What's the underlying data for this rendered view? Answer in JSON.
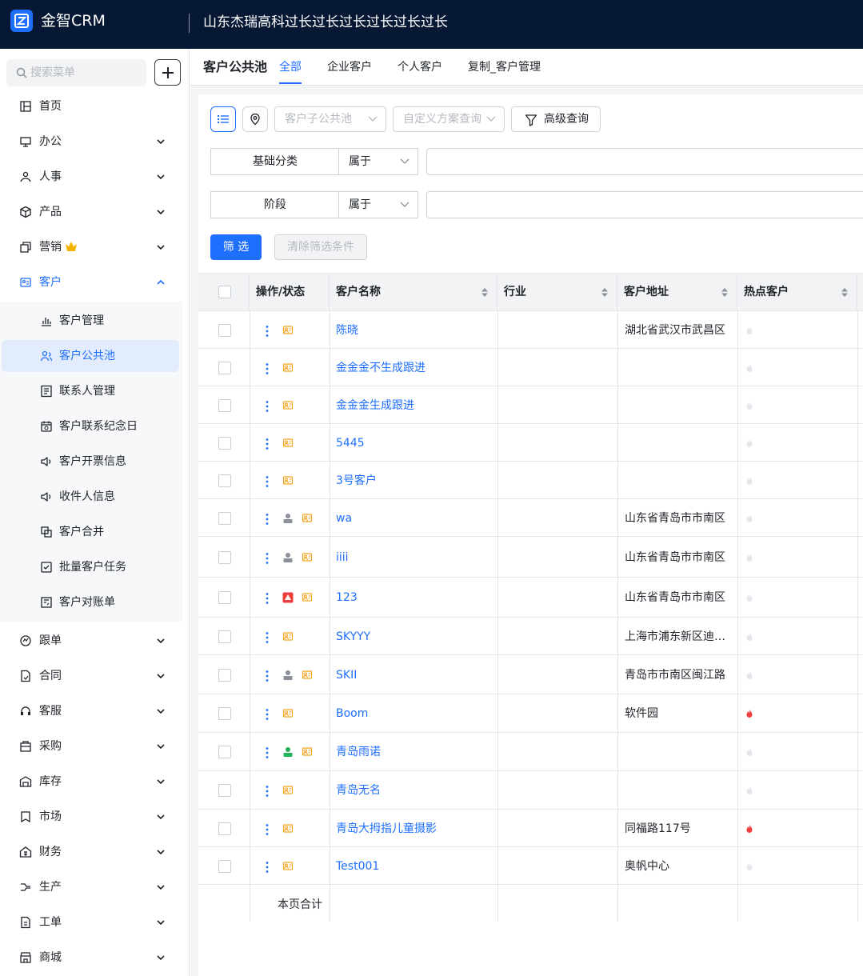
{
  "app": {
    "name": "金智CRM",
    "company": "山东杰瑞高科过长过长过长过长过长过长"
  },
  "sidebar": {
    "search_placeholder": "搜索菜单",
    "items": [
      {
        "label": "首页",
        "icon": "home-icon",
        "expandable": false
      },
      {
        "label": "办公",
        "icon": "office-icon",
        "expandable": true
      },
      {
        "label": "人事",
        "icon": "hr-icon",
        "expandable": true
      },
      {
        "label": "产品",
        "icon": "product-icon",
        "expandable": true
      },
      {
        "label": "营销",
        "icon": "marketing-icon",
        "expandable": true
      },
      {
        "label": "客户",
        "icon": "customer-icon",
        "expandable": true,
        "expanded": true
      },
      {
        "label": "跟单",
        "icon": "followup-icon",
        "expandable": true
      },
      {
        "label": "合同",
        "icon": "contract-icon",
        "expandable": true
      },
      {
        "label": "客服",
        "icon": "service-icon",
        "expandable": true
      },
      {
        "label": "采购",
        "icon": "purchase-icon",
        "expandable": true
      },
      {
        "label": "库存",
        "icon": "inventory-icon",
        "expandable": true
      },
      {
        "label": "市场",
        "icon": "market-icon",
        "expandable": true
      },
      {
        "label": "财务",
        "icon": "finance-icon",
        "expandable": true
      },
      {
        "label": "生产",
        "icon": "production-icon",
        "expandable": true
      },
      {
        "label": "工单",
        "icon": "workorder-icon",
        "expandable": true
      },
      {
        "label": "商城",
        "icon": "mall-icon",
        "expandable": true
      }
    ],
    "sub_items": [
      {
        "label": "客户管理",
        "icon": "chart-icon"
      },
      {
        "label": "客户公共池",
        "icon": "users-icon",
        "active": true
      },
      {
        "label": "联系人管理",
        "icon": "contact-book-icon"
      },
      {
        "label": "客户联系纪念日",
        "icon": "calendar-icon"
      },
      {
        "label": "客户开票信息",
        "icon": "speaker-icon"
      },
      {
        "label": "收件人信息",
        "icon": "speaker-icon"
      },
      {
        "label": "客户合并",
        "icon": "merge-icon"
      },
      {
        "label": "批量客户任务",
        "icon": "task-icon"
      },
      {
        "label": "客户对账单",
        "icon": "statement-icon"
      }
    ],
    "crown_color": "#f5b400"
  },
  "main": {
    "title": "客户公共池",
    "tabs": [
      {
        "label": "全部",
        "active": true
      },
      {
        "label": "企业客户"
      },
      {
        "label": "个人客户"
      },
      {
        "label": "复制_客户管理"
      }
    ],
    "toolbar": {
      "sub_pool_placeholder": "客户子公共池",
      "custom_query_placeholder": "自定义方案查询",
      "advanced_label": "高级查询"
    },
    "filters": [
      {
        "label": "基础分类",
        "op": "属于",
        "value": ""
      },
      {
        "label": "阶段",
        "op": "属于",
        "value": ""
      }
    ],
    "filter_btn": "筛 选",
    "clear_btn": "清除筛选条件",
    "table": {
      "columns": [
        "操作/状态",
        "客户名称",
        "行业",
        "客户地址",
        "热点客户"
      ],
      "rows": [
        {
          "name": "陈晓",
          "industry": "",
          "address": "湖北省武汉市武昌区",
          "hot": false,
          "status": []
        },
        {
          "name": "金金金不生成跟进",
          "industry": "",
          "address": "",
          "hot": false,
          "status": []
        },
        {
          "name": "金金金生成跟进",
          "industry": "",
          "address": "",
          "hot": false,
          "status": []
        },
        {
          "name": "5445",
          "industry": "",
          "address": "",
          "hot": false,
          "status": []
        },
        {
          "name": "3号客户",
          "industry": "",
          "address": "",
          "hot": false,
          "status": []
        },
        {
          "name": "wa",
          "industry": "",
          "address": "山东省青岛市市南区",
          "hot": false,
          "status": [
            "person-gray"
          ]
        },
        {
          "name": "iiii",
          "industry": "",
          "address": "山东省青岛市市南区",
          "hot": false,
          "status": [
            "person-gray"
          ]
        },
        {
          "name": "123",
          "industry": "",
          "address": "山东省青岛市市南区",
          "hot": false,
          "status": [
            "alert-red"
          ]
        },
        {
          "name": "SKYYY",
          "industry": "",
          "address": "上海市浦东新区迪士尼",
          "hot": false,
          "status": []
        },
        {
          "name": "SKII",
          "industry": "",
          "address": "青岛市市南区闽江路",
          "hot": false,
          "status": [
            "person-gray"
          ]
        },
        {
          "name": "Boom",
          "industry": "",
          "address": "软件园",
          "hot": true,
          "status": []
        },
        {
          "name": "青岛雨诺",
          "industry": "",
          "address": "",
          "hot": false,
          "status": [
            "person-green"
          ]
        },
        {
          "name": "青岛无名",
          "industry": "",
          "address": "",
          "hot": false,
          "status": []
        },
        {
          "name": "青岛大拇指儿童摄影",
          "industry": "",
          "address": "同福路117号",
          "hot": true,
          "status": []
        },
        {
          "name": "Test001",
          "industry": "",
          "address": "奥帆中心",
          "hot": false,
          "status": []
        }
      ],
      "total_label": "本页合计"
    }
  },
  "colors": {
    "brand": "#1f6fff",
    "topbar": "#061833",
    "hot": "#f03e3e",
    "card_icon": "#f5a623"
  }
}
